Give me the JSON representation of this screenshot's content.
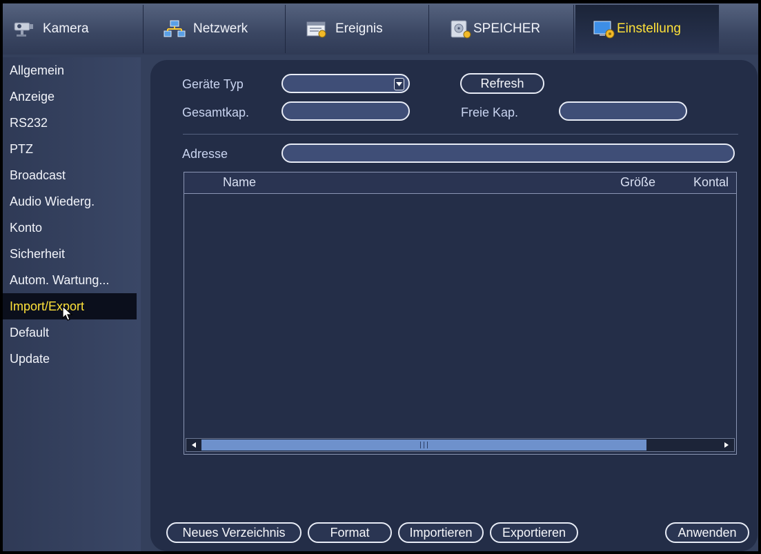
{
  "tabs": [
    {
      "label": "Kamera",
      "icon": "camera-icon"
    },
    {
      "label": "Netzwerk",
      "icon": "network-icon"
    },
    {
      "label": "Ereignis",
      "icon": "event-icon"
    },
    {
      "label": "SPEICHER",
      "icon": "storage-icon"
    },
    {
      "label": "Einstellung",
      "icon": "settings-icon",
      "active": true
    }
  ],
  "sidebar": {
    "items": [
      {
        "label": "Allgemein"
      },
      {
        "label": "Anzeige"
      },
      {
        "label": "RS232"
      },
      {
        "label": "PTZ"
      },
      {
        "label": "Broadcast"
      },
      {
        "label": "Audio Wiederg."
      },
      {
        "label": "Konto"
      },
      {
        "label": "Sicherheit"
      },
      {
        "label": "Autom. Wartung..."
      },
      {
        "label": "Import/Export",
        "active": true
      },
      {
        "label": "Default"
      },
      {
        "label": "Update"
      }
    ]
  },
  "form": {
    "device_type_label": "Geräte Typ",
    "device_type_value": "",
    "refresh_label": "Refresh",
    "total_capacity_label": "Gesamtkap.",
    "total_capacity_value": "",
    "free_capacity_label": "Freie Kap.",
    "free_capacity_value": "",
    "address_label": "Adresse",
    "address_value": ""
  },
  "file_list": {
    "columns": [
      "Name",
      "Größe",
      "Kontal"
    ],
    "rows": []
  },
  "buttons": {
    "new_folder": "Neues Verzeichnis",
    "format": "Format",
    "import": "Importieren",
    "export": "Exportieren",
    "apply": "Anwenden"
  },
  "colors": {
    "accent_active": "#ffe23a",
    "panel": "#232d47",
    "background": "#34405c"
  }
}
